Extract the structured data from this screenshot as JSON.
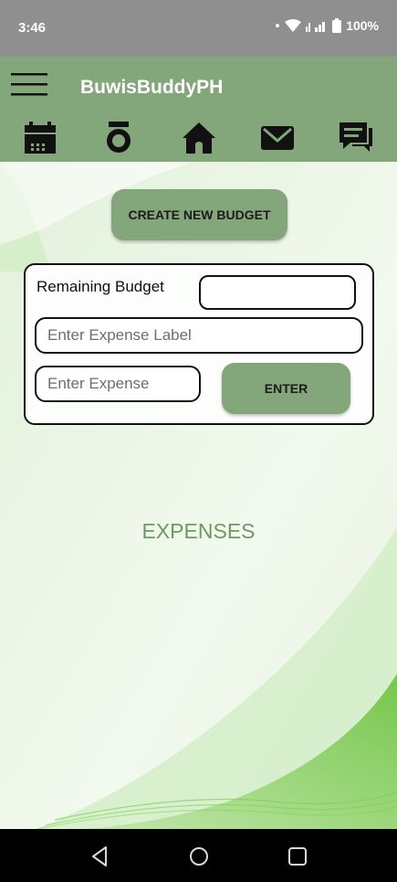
{
  "status_bar": {
    "time": "3:46",
    "battery": "100%"
  },
  "app_bar": {
    "title": "BuwisBuddyPH",
    "tabs": [
      {
        "icon": "calendar-icon"
      },
      {
        "icon": "camera-icon"
      },
      {
        "icon": "home-icon"
      },
      {
        "icon": "mail-icon"
      },
      {
        "icon": "chat-icon"
      }
    ]
  },
  "main": {
    "create_button_label": "CREATE NEW BUDGET",
    "remaining_label": "Remaining Budget",
    "remaining_value": "",
    "expense_label_placeholder": "Enter Expense Label",
    "expense_placeholder": "Enter Expense",
    "enter_button_label": "ENTER",
    "expenses_heading": "EXPENSES"
  },
  "colors": {
    "app_bar": "#84a67b",
    "status_bar": "#8f8f8f",
    "heading": "#6f9866",
    "nav_bar": "#000000"
  }
}
